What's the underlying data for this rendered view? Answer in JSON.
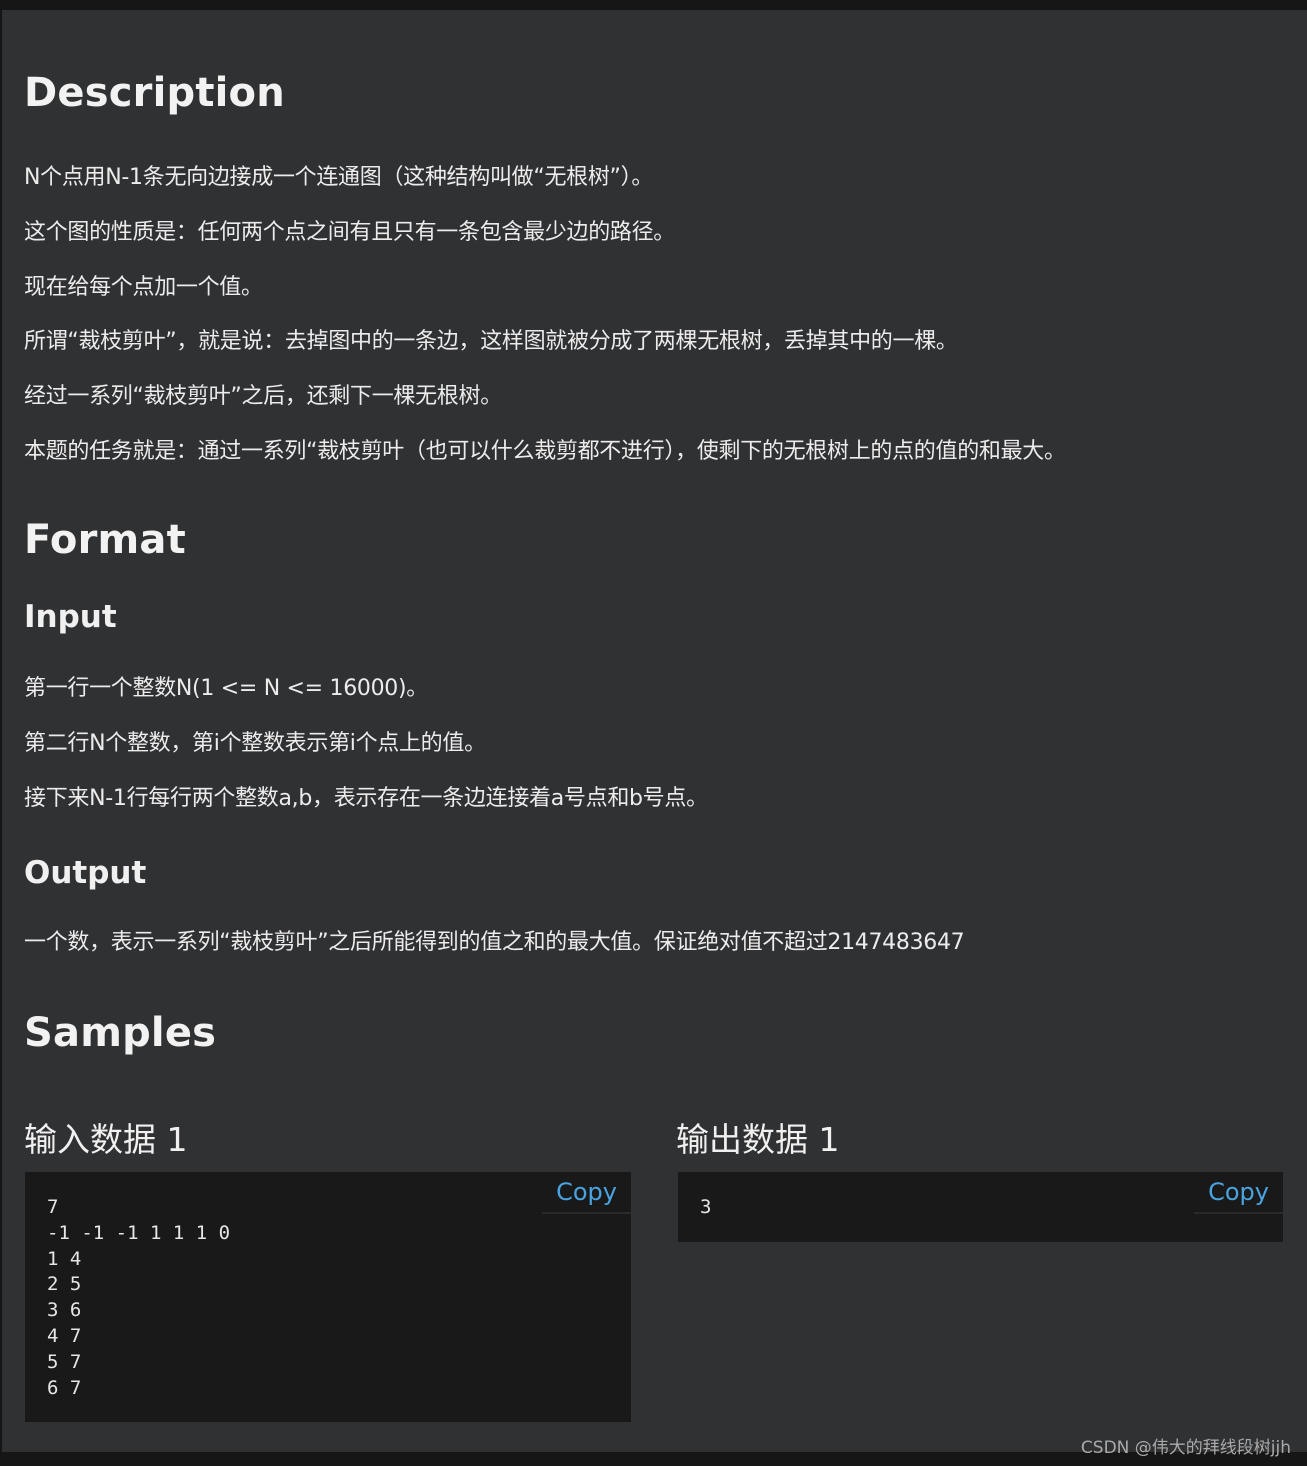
{
  "description": {
    "title": "Description",
    "paragraphs": [
      "N个点用N-1条无向边接成一个连通图（这种结构叫做“无根树”）。",
      "这个图的性质是：任何两个点之间有且只有一条包含最少边的路径。",
      "现在给每个点加一个值。",
      "所谓“裁枝剪叶”，就是说：去掉图中的一条边，这样图就被分成了两棵无根树，丢掉其中的一棵。",
      "经过一系列“裁枝剪叶”之后，还剩下一棵无根树。",
      "本题的任务就是：通过一系列“裁枝剪叶（也可以什么裁剪都不进行），使剩下的无根树上的点的值的和最大。"
    ]
  },
  "format": {
    "title": "Format",
    "input": {
      "title": "Input",
      "paragraphs": [
        "第一行一个整数N(1 <= N <= 16000)。",
        "第二行N个整数，第i个整数表示第i个点上的值。",
        "接下来N-1行每行两个整数a,b，表示存在一条边连接着a号点和b号点。"
      ]
    },
    "output": {
      "title": "Output",
      "paragraphs": [
        "一个数，表示一系列“裁枝剪叶”之后所能得到的值之和的最大值。保证绝对值不超过2147483647"
      ]
    }
  },
  "samples": {
    "title": "Samples",
    "input": {
      "title": "输入数据 1",
      "copy_label": "Copy",
      "content": "7\n-1 -1 -1 1 1 1 0\n1 4\n2 5\n3 6\n4 7\n5 7\n6 7"
    },
    "output": {
      "title": "输出数据 1",
      "copy_label": "Copy",
      "content": "3"
    }
  },
  "footer": "CSDN @伟大的拜线段树jjh",
  "colors": {
    "background": "#303133",
    "code_background": "#191919",
    "copy_link": "#4aa3df"
  }
}
